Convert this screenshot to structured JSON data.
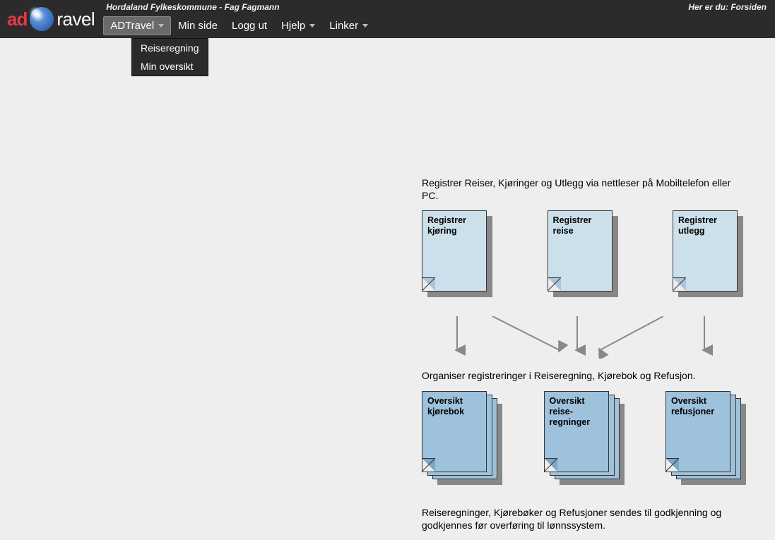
{
  "header": {
    "info_left": "Hordaland Fylkeskommune - Fag Fagmann",
    "info_right": "Her er du: Forsiden",
    "logo_part1": "ad",
    "logo_part2": "ravel"
  },
  "menu": {
    "items": [
      {
        "label": "ADTravel",
        "has_caret": true,
        "active": true
      },
      {
        "label": "Min side",
        "has_caret": false
      },
      {
        "label": "Logg ut",
        "has_caret": false
      },
      {
        "label": "Hjelp",
        "has_caret": true
      },
      {
        "label": "Linker",
        "has_caret": true
      }
    ],
    "dropdown": [
      {
        "label": "Reiseregning"
      },
      {
        "label": "Min oversikt"
      }
    ]
  },
  "content": {
    "instruction1": "Registrer Reiser, Kjøringer og Utlegg via nettleser på Mobiltelefon eller PC.",
    "row1": [
      {
        "label": "Registrer kjøring"
      },
      {
        "label": "Registrer reise"
      },
      {
        "label": "Registrer utlegg"
      }
    ],
    "instruction2": "Organiser registreringer i Reiseregning, Kjørebok og Refusjon.",
    "row2": [
      {
        "label": "Oversikt kjørebok"
      },
      {
        "label": "Oversikt reise-regninger"
      },
      {
        "label": "Oversikt refusjoner"
      }
    ],
    "instruction3": "Reiseregninger, Kjørebøker og Refusjoner sendes til godkjenning og godkjennes før overføring til lønnssystem."
  }
}
